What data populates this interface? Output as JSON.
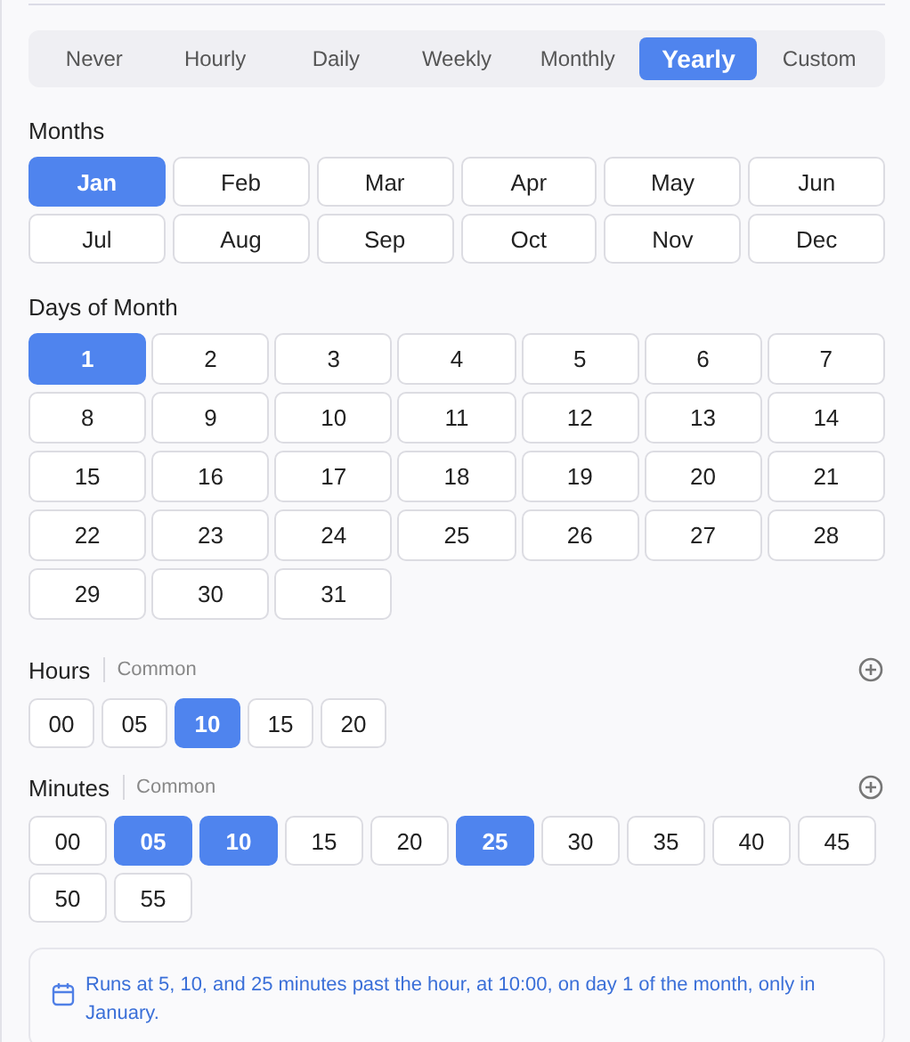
{
  "frequency_tabs": [
    {
      "label": "Never",
      "selected": false
    },
    {
      "label": "Hourly",
      "selected": false
    },
    {
      "label": "Daily",
      "selected": false
    },
    {
      "label": "Weekly",
      "selected": false
    },
    {
      "label": "Monthly",
      "selected": false
    },
    {
      "label": "Yearly",
      "selected": true
    },
    {
      "label": "Custom",
      "selected": false
    }
  ],
  "months": {
    "title": "Months",
    "items": [
      {
        "label": "Jan",
        "selected": true
      },
      {
        "label": "Feb",
        "selected": false
      },
      {
        "label": "Mar",
        "selected": false
      },
      {
        "label": "Apr",
        "selected": false
      },
      {
        "label": "May",
        "selected": false
      },
      {
        "label": "Jun",
        "selected": false
      },
      {
        "label": "Jul",
        "selected": false
      },
      {
        "label": "Aug",
        "selected": false
      },
      {
        "label": "Sep",
        "selected": false
      },
      {
        "label": "Oct",
        "selected": false
      },
      {
        "label": "Nov",
        "selected": false
      },
      {
        "label": "Dec",
        "selected": false
      }
    ]
  },
  "days": {
    "title": "Days of Month",
    "items": [
      {
        "label": "1",
        "selected": true
      },
      {
        "label": "2",
        "selected": false
      },
      {
        "label": "3",
        "selected": false
      },
      {
        "label": "4",
        "selected": false
      },
      {
        "label": "5",
        "selected": false
      },
      {
        "label": "6",
        "selected": false
      },
      {
        "label": "7",
        "selected": false
      },
      {
        "label": "8",
        "selected": false
      },
      {
        "label": "9",
        "selected": false
      },
      {
        "label": "10",
        "selected": false
      },
      {
        "label": "11",
        "selected": false
      },
      {
        "label": "12",
        "selected": false
      },
      {
        "label": "13",
        "selected": false
      },
      {
        "label": "14",
        "selected": false
      },
      {
        "label": "15",
        "selected": false
      },
      {
        "label": "16",
        "selected": false
      },
      {
        "label": "17",
        "selected": false
      },
      {
        "label": "18",
        "selected": false
      },
      {
        "label": "19",
        "selected": false
      },
      {
        "label": "20",
        "selected": false
      },
      {
        "label": "21",
        "selected": false
      },
      {
        "label": "22",
        "selected": false
      },
      {
        "label": "23",
        "selected": false
      },
      {
        "label": "24",
        "selected": false
      },
      {
        "label": "25",
        "selected": false
      },
      {
        "label": "26",
        "selected": false
      },
      {
        "label": "27",
        "selected": false
      },
      {
        "label": "28",
        "selected": false
      },
      {
        "label": "29",
        "selected": false
      },
      {
        "label": "30",
        "selected": false
      },
      {
        "label": "31",
        "selected": false
      }
    ]
  },
  "hours": {
    "title": "Hours",
    "subtitle": "Common",
    "items": [
      {
        "label": "00",
        "selected": false
      },
      {
        "label": "05",
        "selected": false
      },
      {
        "label": "10",
        "selected": true
      },
      {
        "label": "15",
        "selected": false
      },
      {
        "label": "20",
        "selected": false
      }
    ]
  },
  "minutes": {
    "title": "Minutes",
    "subtitle": "Common",
    "items": [
      {
        "label": "00",
        "selected": false
      },
      {
        "label": "05",
        "selected": true
      },
      {
        "label": "10",
        "selected": true
      },
      {
        "label": "15",
        "selected": false
      },
      {
        "label": "20",
        "selected": false
      },
      {
        "label": "25",
        "selected": true
      },
      {
        "label": "30",
        "selected": false
      },
      {
        "label": "35",
        "selected": false
      },
      {
        "label": "40",
        "selected": false
      },
      {
        "label": "45",
        "selected": false
      },
      {
        "label": "50",
        "selected": false
      },
      {
        "label": "55",
        "selected": false
      }
    ]
  },
  "summary": "Runs at 5, 10, and 25 minutes past the hour, at 10:00, on day 1 of the month, only in January."
}
